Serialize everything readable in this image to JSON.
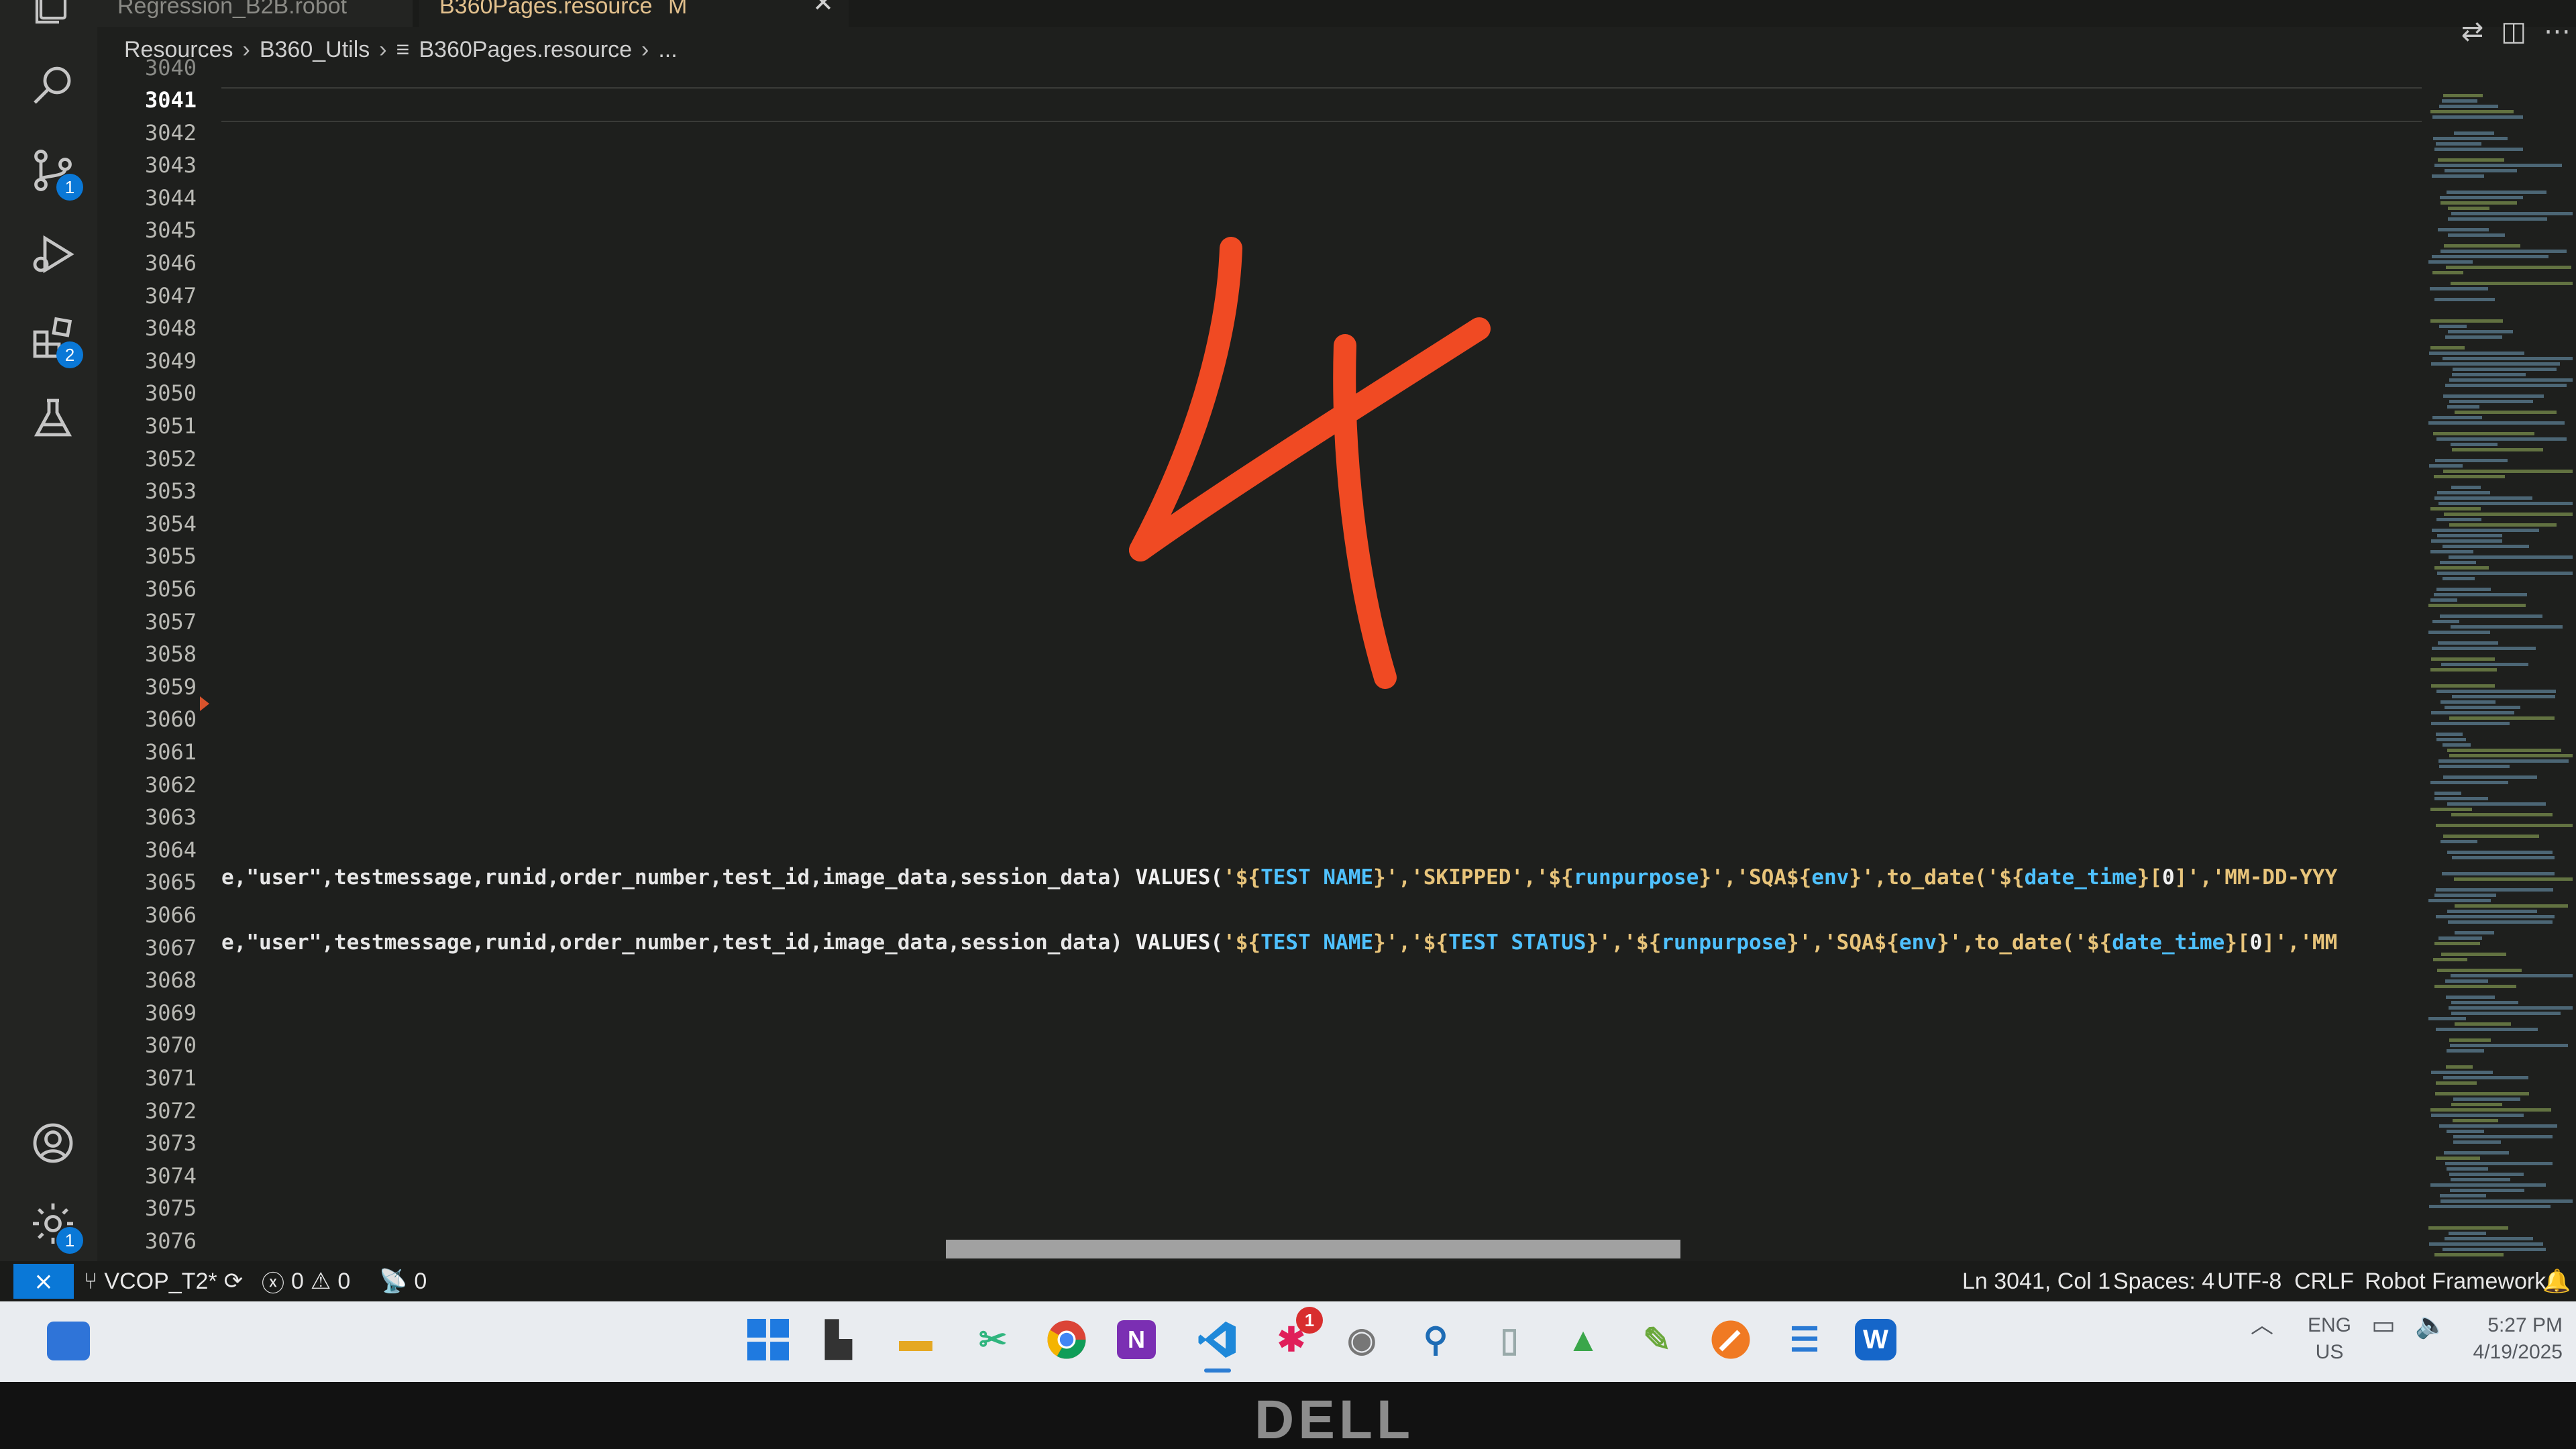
{
  "tabs": [
    {
      "label": "Regression_B2B.robot",
      "active": false
    },
    {
      "label": "B360Pages.resource",
      "modified_flag": "M",
      "active": true
    }
  ],
  "breadcrumb": [
    "Resources",
    "B360_Utils",
    "B360Pages.resource",
    "..."
  ],
  "activity_bar": {
    "source_control_badge": "1",
    "extensions_badge": "2",
    "settings_badge": "1"
  },
  "editor": {
    "partial_top_line": "3040",
    "line_numbers": [
      "3041",
      "3042",
      "3043",
      "3044",
      "3045",
      "3046",
      "3047",
      "3048",
      "3049",
      "3050",
      "3051",
      "3052",
      "3053",
      "3054",
      "3055",
      "3056",
      "3057",
      "3058",
      "3059",
      "3060",
      "3061",
      "3062",
      "3063",
      "3064",
      "3065",
      "3066",
      "3067",
      "3068",
      "3069",
      "3070",
      "3071",
      "3072",
      "3073",
      "3074",
      "3075",
      "3076"
    ],
    "current_line": "3041",
    "line_3065": {
      "prefix": "e,",
      "columns": "\"user\",testmessage,runid,order_number,test_id,image_data,session_data)",
      "values_kw": "VALUES(",
      "p1": "'${",
      "v1": "TEST NAME",
      "p2": "}','SKIPPED','${",
      "v2": "runpurpose",
      "p3": "}','SQA${",
      "v3": "env",
      "p4": "}',to_date('${",
      "v4": "date_time",
      "p5": "}[",
      "v5": "0",
      "p6": "]','MM-DD-YYY"
    },
    "line_3067": {
      "prefix": "e,",
      "columns": "\"user\",testmessage,runid,order_number,test_id,image_data,session_data)",
      "values_kw": "VALUES(",
      "p1": "'${",
      "v1": "TEST NAME",
      "p2": "}','${",
      "v2": "TEST STATUS",
      "p3": "}','${",
      "v3": "runpurpose",
      "p4": "}','SQA${",
      "v4": "env",
      "p5": "}',to_date('${",
      "v5": "date_time",
      "p6": "}[",
      "v6": "0",
      "p7": "]','MM"
    }
  },
  "statusbar": {
    "branch": "VCOP_T2*",
    "errors": "0",
    "warnings": "0",
    "ports": "0",
    "cursor_position": "Ln 3041, Col 1",
    "spaces": "Spaces: 4",
    "encoding": "UTF-8",
    "line_ending": "CRLF",
    "language": "Robot Framework"
  },
  "taskbar": {
    "apps": [
      "windows-start",
      "task-view",
      "file-explorer",
      "snipping-tool",
      "chrome",
      "onenote",
      "vscode",
      "slack",
      "app-icon",
      "network-app",
      "file-app",
      "green-app",
      "notes-app",
      "pen-app",
      "notepad",
      "webex"
    ],
    "slack_badge": "1",
    "language": "ENG",
    "region": "US",
    "time": "5:27 PM",
    "date": "4/19/2025"
  },
  "bezel": {
    "brand": "DELL"
  },
  "colors": {
    "accent_blue": "#0a78d7",
    "annotation_red": "#f04a23",
    "string_yellow": "#e8c47a",
    "variable_blue": "#4fc1ff"
  }
}
